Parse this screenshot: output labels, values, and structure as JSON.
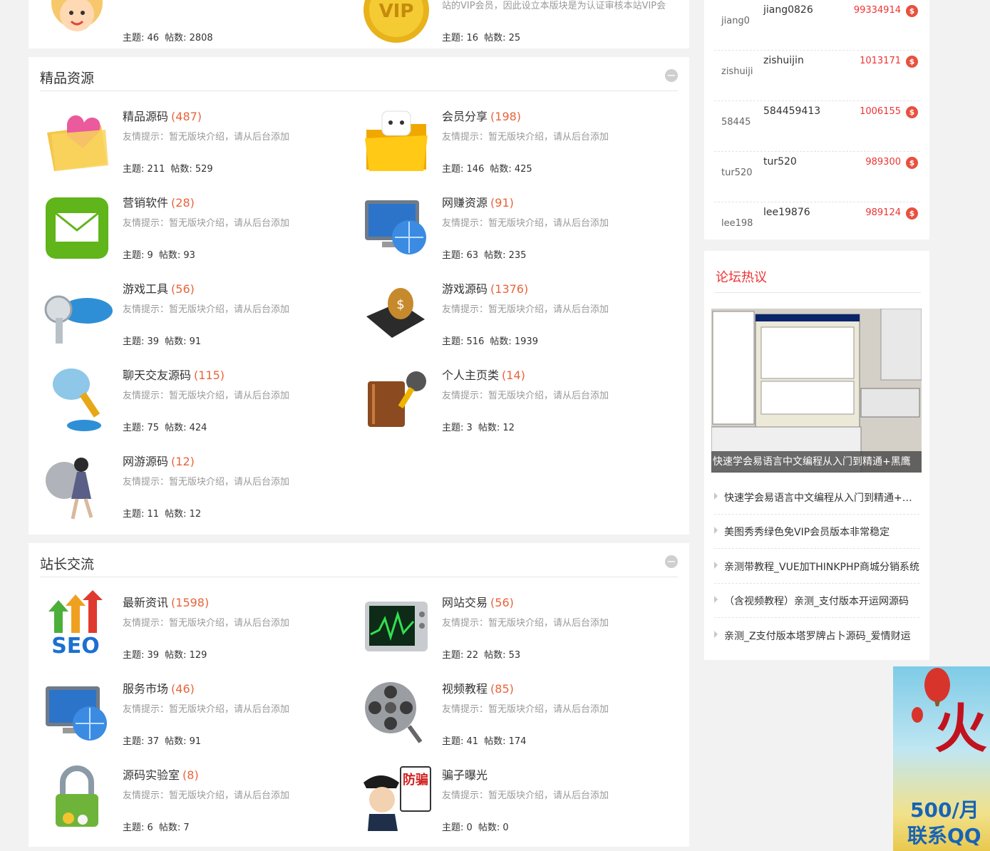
{
  "top_forums": [
    {
      "desc": "",
      "topics_label": "主题:",
      "topics": "46",
      "posts_label": "帖数:",
      "posts": "2808"
    },
    {
      "desc": "站的VIP会员，因此设立本版块是为认证审核本站VIP会",
      "topics_label": "主题:",
      "topics": "16",
      "posts_label": "帖数:",
      "posts": "25"
    }
  ],
  "sections": [
    {
      "title": "精品资源",
      "collapse_icon": "minus",
      "forums": [
        {
          "name": "精品源码",
          "count": "(487)",
          "desc": "友情提示：暂无版块介绍，请从后台添加",
          "topics_label": "主题:",
          "topics": "211",
          "posts_label": "帖数:",
          "posts": "529",
          "icon": "folder-heart-icon"
        },
        {
          "name": "会员分享",
          "count": "(198)",
          "desc": "友情提示：暂无版块介绍，请从后台添加",
          "topics_label": "主题:",
          "topics": "146",
          "posts_label": "帖数:",
          "posts": "425",
          "icon": "folder-cat-icon"
        },
        {
          "name": "营销软件",
          "count": "(28)",
          "desc": "友情提示：暂无版块介绍，请从后台添加",
          "topics_label": "主题:",
          "topics": "9",
          "posts_label": "帖数:",
          "posts": "93",
          "icon": "envelope-icon"
        },
        {
          "name": "网赚资源",
          "count": "(91)",
          "desc": "友情提示：暂无版块介绍，请从后台添加",
          "topics_label": "主题:",
          "topics": "63",
          "posts_label": "帖数:",
          "posts": "235",
          "icon": "network-monitor-icon"
        },
        {
          "name": "游戏工具",
          "count": "(56)",
          "desc": "友情提示：暂无版块介绍，请从后台添加",
          "topics_label": "主题:",
          "topics": "39",
          "posts_label": "帖数:",
          "posts": "91",
          "icon": "key-icon"
        },
        {
          "name": "游戏源码",
          "count": "(1376)",
          "desc": "友情提示：暂无版块介绍，请从后台添加",
          "topics_label": "主题:",
          "topics": "516",
          "posts_label": "帖数:",
          "posts": "1939",
          "icon": "money-briefcase-icon"
        },
        {
          "name": "聊天交友源码",
          "count": "(115)",
          "desc": "友情提示：暂无版块介绍，请从后台添加",
          "topics_label": "主题:",
          "topics": "75",
          "posts_label": "帖数:",
          "posts": "424",
          "icon": "microphone-icon"
        },
        {
          "name": "个人主页类",
          "count": "(14)",
          "desc": "友情提示：暂无版块介绍，请从后台添加",
          "topics_label": "主题:",
          "topics": "3",
          "posts_label": "帖数:",
          "posts": "12",
          "icon": "notebook-icon"
        },
        {
          "name": "网游源码",
          "count": "(12)",
          "desc": "友情提示：暂无版块介绍，请从后台添加",
          "topics_label": "主题:",
          "topics": "11",
          "posts_label": "帖数:",
          "posts": "12",
          "icon": "game-character-icon"
        }
      ]
    },
    {
      "title": "站长交流",
      "collapse_icon": "minus",
      "forums": [
        {
          "name": "最新资讯",
          "count": "(1598)",
          "desc": "友情提示：暂无版块介绍，请从后台添加",
          "topics_label": "主题:",
          "topics": "39",
          "posts_label": "帖数:",
          "posts": "129",
          "icon": "seo-icon"
        },
        {
          "name": "网站交易",
          "count": "(56)",
          "desc": "友情提示：暂无版块介绍，请从后台添加",
          "topics_label": "主题:",
          "topics": "22",
          "posts_label": "帖数:",
          "posts": "53",
          "icon": "monitor-graph-icon"
        },
        {
          "name": "服务市场",
          "count": "(46)",
          "desc": "友情提示：暂无版块介绍，请从后台添加",
          "topics_label": "主题:",
          "topics": "37",
          "posts_label": "帖数:",
          "posts": "91",
          "icon": "network-monitor-icon"
        },
        {
          "name": "视频教程",
          "count": "(85)",
          "desc": "友情提示：暂无版块介绍，请从后台添加",
          "topics_label": "主题:",
          "topics": "41",
          "posts_label": "帖数:",
          "posts": "174",
          "icon": "film-reel-icon"
        },
        {
          "name": "源码实验室",
          "count": "(8)",
          "desc": "友情提示：暂无版块介绍，请从后台添加",
          "topics_label": "主题:",
          "topics": "6",
          "posts_label": "帖数:",
          "posts": "7",
          "icon": "padlock-icon"
        },
        {
          "name": "骗子曝光",
          "count": "",
          "desc": "友情提示：暂无版块介绍，请从后台添加",
          "topics_label": "主题:",
          "topics": "0",
          "posts_label": "帖数:",
          "posts": "0",
          "icon": "police-icon",
          "icon_text": "防骗"
        }
      ]
    }
  ],
  "ranking": [
    {
      "avatar": "jiang0",
      "name": "jiang0826",
      "value": "99334914",
      "coin": "$"
    },
    {
      "avatar": "zishuiji",
      "name": "zishuijin",
      "value": "1013171",
      "coin": "$"
    },
    {
      "avatar": "58445",
      "name": "584459413",
      "value": "1006155",
      "coin": "$"
    },
    {
      "avatar": "tur520",
      "name": "tur520",
      "value": "989300",
      "coin": "$"
    },
    {
      "avatar": "lee198",
      "name": "lee19876",
      "value": "989124",
      "coin": "$"
    }
  ],
  "hot": {
    "title": "论坛热议",
    "featured_caption": "快速学会易语言中文编程从入门到精通+黑鹰",
    "items": [
      "快速学会易语言中文编程从入门到精通+黑鹰",
      "美图秀秀绿色免VIP会员版本非常稳定",
      "亲测带教程_VUE加THINKPHP商城分销系统",
      "（含视频教程）亲测_支付版本开运网源码",
      "亲测_Z支付版本塔罗牌占卜源码_爱情财运"
    ]
  },
  "ad": {
    "big_text": "火",
    "price": "500/月",
    "contact": "联系QQ"
  },
  "colors": {
    "accent_red": "#e33333",
    "count_orange": "#e8643a",
    "desc_gray": "#999999"
  }
}
